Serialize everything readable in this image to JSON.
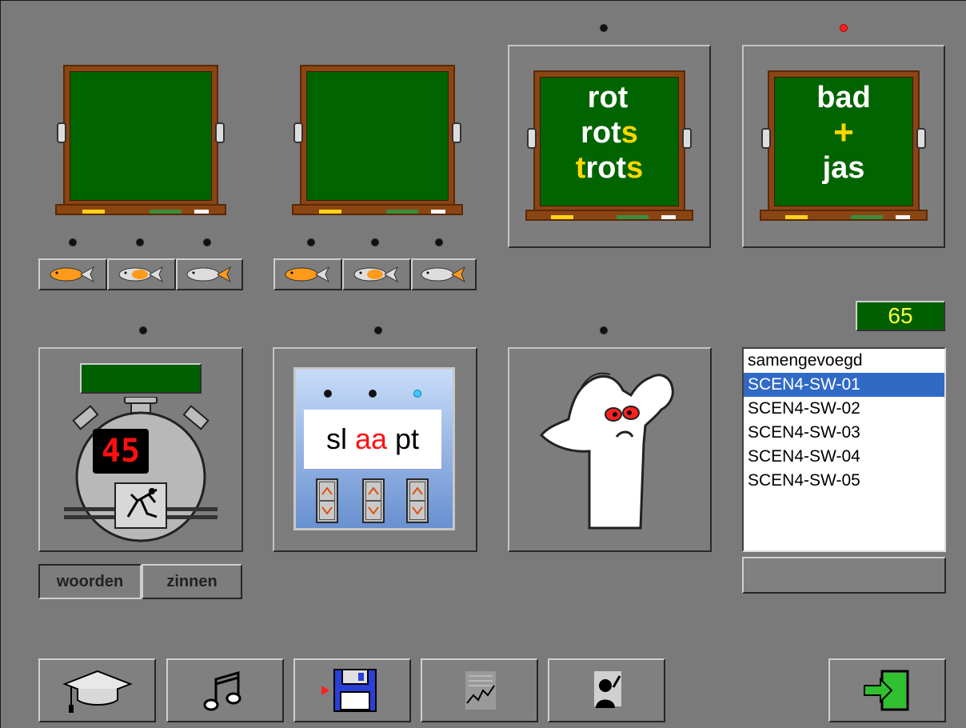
{
  "board3": {
    "line1": "rot",
    "line2a": "rot",
    "line2b": "s",
    "line3a": "t",
    "line3b": "rot",
    "line3c": "s"
  },
  "board4": {
    "line1": "bad",
    "plus": "+",
    "line3": "jas"
  },
  "score": "65",
  "timer": {
    "display": "45"
  },
  "mode_toggle": {
    "words": "woorden",
    "sentences": "zinnen"
  },
  "word_builder": {
    "left": "sl",
    "middle": "aa",
    "right": "pt"
  },
  "list": {
    "items": [
      "samengevoegd",
      "SCEN4-SW-01",
      "SCEN4-SW-02",
      "SCEN4-SW-03",
      "SCEN4-SW-04",
      "SCEN4-SW-05"
    ],
    "selected_index": 1
  },
  "toolbar": {
    "icons": [
      "graduation-cap-icon",
      "music-notes-icon",
      "save-disk-icon",
      "chart-icon",
      "teacher-icon",
      "exit-icon"
    ]
  },
  "colors": {
    "board_green": "#006400",
    "chalk_yellow": "#ffd700",
    "score_text": "#ffff40",
    "selection_blue": "#316ac5"
  }
}
